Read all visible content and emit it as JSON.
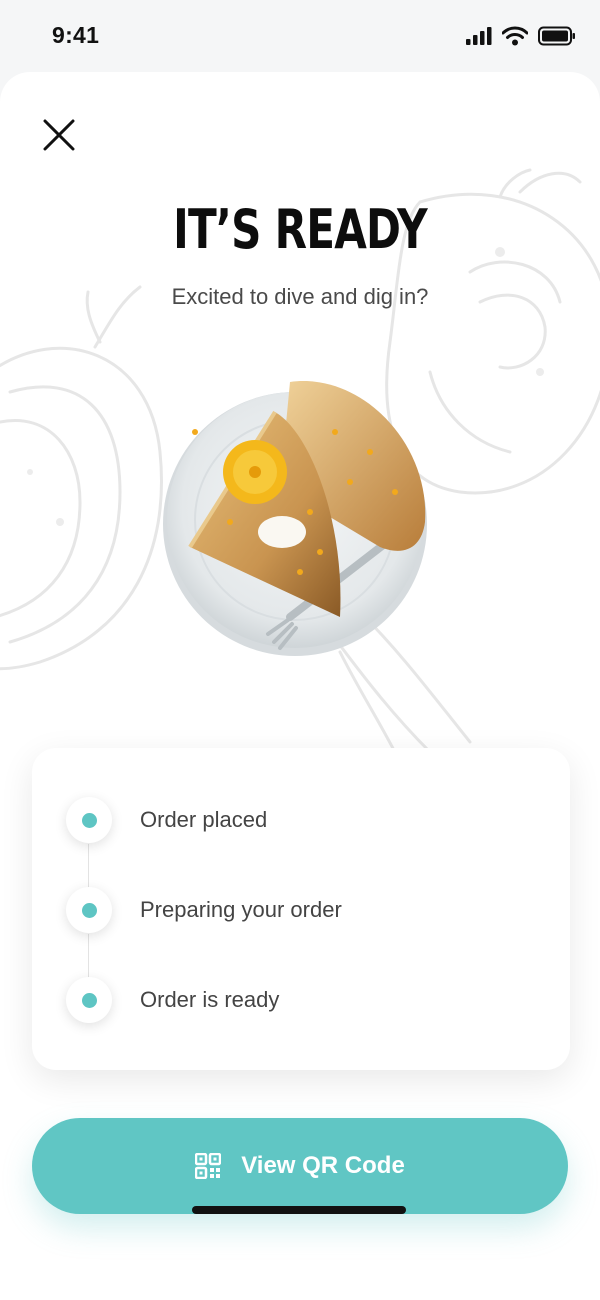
{
  "status_bar": {
    "time": "9:41"
  },
  "header": {
    "title": "IT’S READY",
    "subtitle": "Excited to dive and dig in?"
  },
  "order_progress": {
    "steps": [
      {
        "label": "Order placed"
      },
      {
        "label": "Preparing your order"
      },
      {
        "label": "Order is ready"
      }
    ]
  },
  "actions": {
    "qr_button_label": "View QR Code"
  },
  "colors": {
    "accent": "#5ec5c3",
    "button": "#60c6c4",
    "title": "#0d0d0d",
    "text": "#444444"
  },
  "icons": {
    "close": "close-icon",
    "qr": "qr-code-icon",
    "signal": "signal-icon",
    "wifi": "wifi-icon",
    "battery": "battery-icon"
  }
}
